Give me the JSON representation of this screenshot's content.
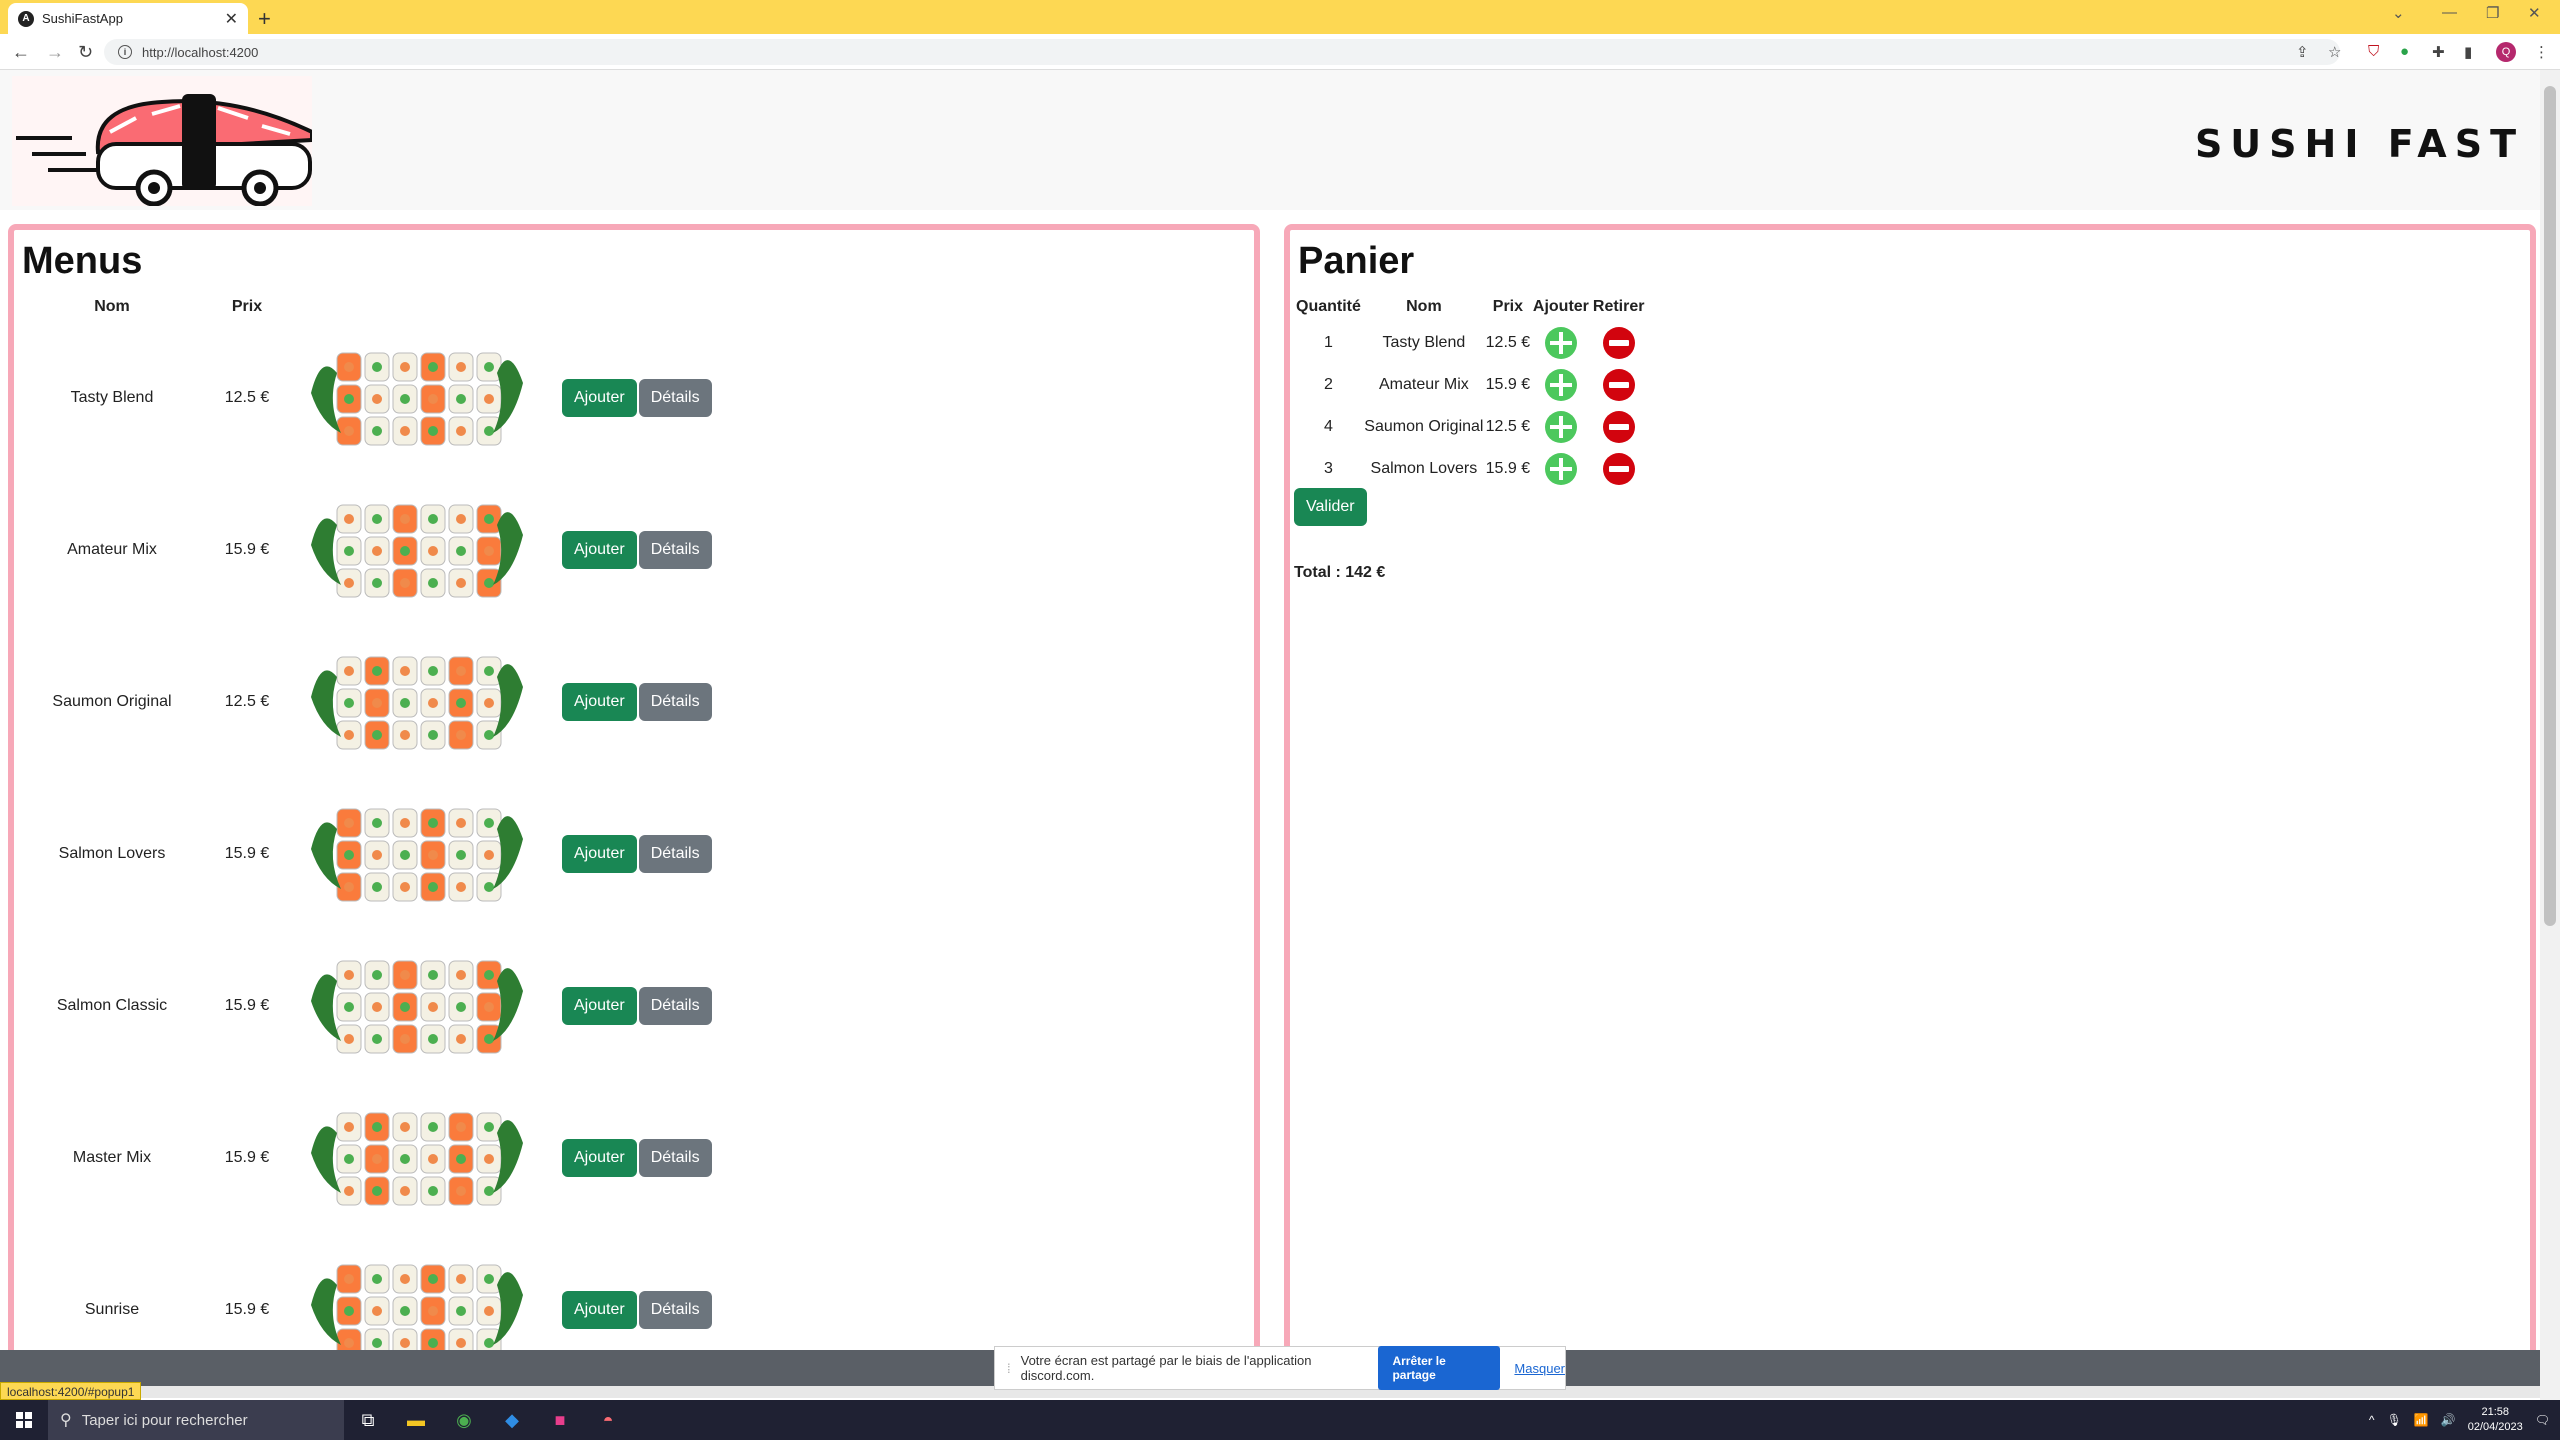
{
  "browser": {
    "tab_title": "SushiFastApp",
    "url": "http://localhost:4200",
    "status_url": "localhost:4200/#popup1"
  },
  "header": {
    "brand": "SUSHI FAST"
  },
  "menus": {
    "title": "Menus",
    "col_nom": "Nom",
    "col_prix": "Prix",
    "add_label": "Ajouter",
    "details_label": "Détails",
    "items": [
      {
        "nom": "Tasty Blend",
        "prix": "12.5 €"
      },
      {
        "nom": "Amateur Mix",
        "prix": "15.9 €"
      },
      {
        "nom": "Saumon Original",
        "prix": "12.5 €"
      },
      {
        "nom": "Salmon Lovers",
        "prix": "15.9 €"
      },
      {
        "nom": "Salmon Classic",
        "prix": "15.9 €"
      },
      {
        "nom": "Master Mix",
        "prix": "15.9 €"
      },
      {
        "nom": "Sunrise",
        "prix": "15.9 €"
      }
    ]
  },
  "panier": {
    "title": "Panier",
    "col_quantite": "Quantité",
    "col_nom": "Nom",
    "col_prix": "Prix",
    "col_ajouter": "Ajouter",
    "col_retirer": "Retirer",
    "items": [
      {
        "quantite": "1",
        "nom": "Tasty Blend",
        "prix": "12.5 €"
      },
      {
        "quantite": "2",
        "nom": "Amateur Mix",
        "prix": "15.9 €"
      },
      {
        "quantite": "4",
        "nom": "Saumon Original",
        "prix": "12.5 €"
      },
      {
        "quantite": "3",
        "nom": "Salmon Lovers",
        "prix": "15.9 €"
      }
    ],
    "valider_label": "Valider",
    "total": "Total : 142 €"
  },
  "sharebar": {
    "message": "Votre écran est partagé par le biais de l'application discord.com.",
    "stop_label": "Arrêter le partage",
    "hide_label": "Masquer"
  },
  "taskbar": {
    "search_placeholder": "Taper ici pour rechercher",
    "time": "21:58",
    "date": "02/04/2023"
  },
  "colors": {
    "tabbar": "#fdd853",
    "panel_border": "#f7a8b8",
    "btn_green": "#198754",
    "btn_grey": "#6c757d",
    "plus": "#4cc85d",
    "minus": "#d2040e"
  }
}
